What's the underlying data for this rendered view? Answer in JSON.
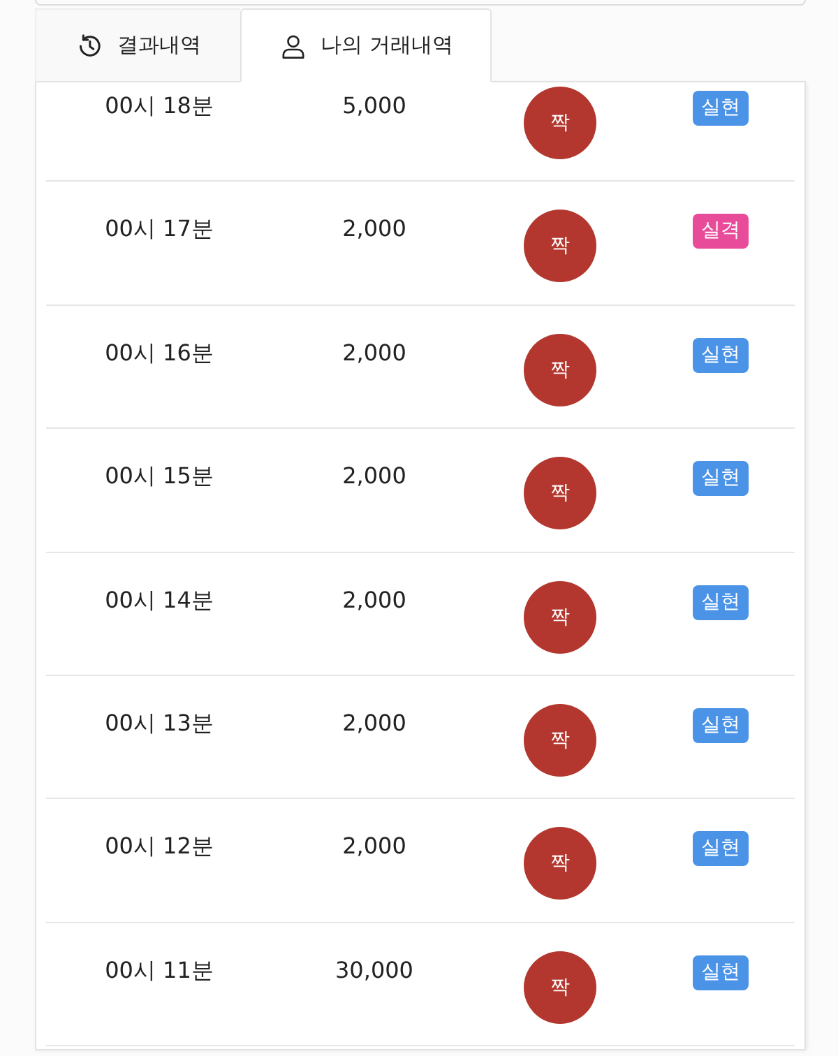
{
  "tabs": [
    {
      "label": "결과내역",
      "selected": false
    },
    {
      "label": "나의 거래내역",
      "selected": true
    }
  ],
  "rows": [
    {
      "time": "00시 18분",
      "amount": "5,000",
      "pick": "짝",
      "result": {
        "label": "실현",
        "color": "#4a93e6"
      }
    },
    {
      "time": "00시 17분",
      "amount": "2,000",
      "pick": "짝",
      "result": {
        "label": "실격",
        "color": "#e94b9b"
      }
    },
    {
      "time": "00시 16분",
      "amount": "2,000",
      "pick": "짝",
      "result": {
        "label": "실현",
        "color": "#4a93e6"
      }
    },
    {
      "time": "00시 15분",
      "amount": "2,000",
      "pick": "짝",
      "result": {
        "label": "실현",
        "color": "#4a93e6"
      }
    },
    {
      "time": "00시 14분",
      "amount": "2,000",
      "pick": "짝",
      "result": {
        "label": "실현",
        "color": "#4a93e6"
      }
    },
    {
      "time": "00시 13분",
      "amount": "2,000",
      "pick": "짝",
      "result": {
        "label": "실현",
        "color": "#4a93e6"
      }
    },
    {
      "time": "00시 12분",
      "amount": "2,000",
      "pick": "짝",
      "result": {
        "label": "실현",
        "color": "#4a93e6"
      }
    },
    {
      "time": "00시 11분",
      "amount": "30,000",
      "pick": "짝",
      "result": {
        "label": "실현",
        "color": "#4a93e6"
      }
    }
  ]
}
